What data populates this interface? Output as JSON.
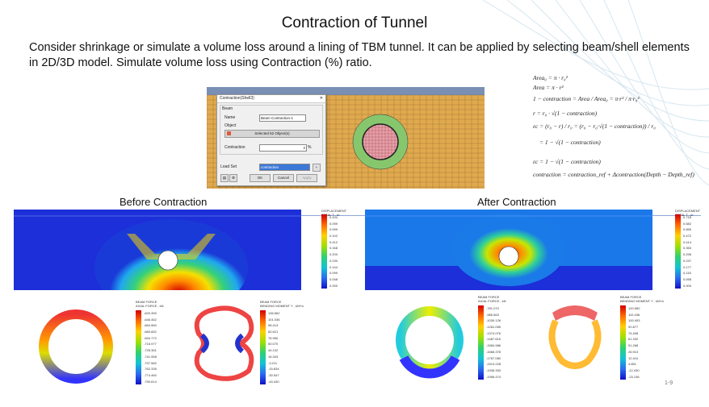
{
  "slide": {
    "title": "Contraction of Tunnel",
    "body": "Consider shrinkage or simulate a volume loss around a lining of TBM tunnel. It can be applied by selecting beam/shell elements in 2D/3D model. Simulate volume loss using Contraction (%) ratio.",
    "page_number": "1-9"
  },
  "dialog": {
    "title": "Contraction(Shell3)",
    "close": "✕",
    "group_beam": "Beam",
    "name_label": "Name",
    "name_value": "Beam Contraction-1",
    "object_label": "Object",
    "object_button": "Selected 52 Object(s)",
    "contraction_label": "Contraction",
    "contraction_value": "2",
    "contraction_unit": "%",
    "load_set_label": "Load Set",
    "load_set_value": "contraction",
    "ok": "OK",
    "cancel": "Cancel",
    "apply": "Apply"
  },
  "formulas": [
    "Area₀ = π · r₀²",
    "Area = π · r²",
    "1 − contraction = Area / Area₀ = π·r² / π·r₀²",
    "r = r₀ · √(1 − contraction)",
    "εc = (r₀ − r) / r₀ = (r₀ − r₀·√(1 − contraction)) / r₀",
    "= 1 − √(1 − contraction)",
    "εc = 1 − √(1 − contraction)",
    "contraction = contraction_ref + Δcontraction(Depth − Depth_ref)"
  ],
  "before": {
    "label": "Before Contraction",
    "legend_title": "DISPLACEMENT\nTOTAL T , m",
    "legend_values": [
      "0.104",
      "0.099",
      "0.099",
      "0.102",
      "0.412",
      "0.348",
      "0.203",
      "0.230",
      "0.144",
      "0.099",
      "0.048",
      "0.000"
    ]
  },
  "after": {
    "label": "After Contraction",
    "legend_title": "DISPLACEMENT\nTOTAL T , m",
    "legend_values": [
      "0.718",
      "0.582",
      "0.565",
      "0.472",
      "0.414",
      "0.353",
      "0.296",
      "0.237",
      "0.177",
      "0.118",
      "0.058",
      "0.000"
    ]
  },
  "force_plots": [
    {
      "legend_title": "BEAM FORCE\nAXIAL FORCE , kN",
      "values": [
        "-629.390",
        "-646.462",
        "-664.560",
        "-680.652",
        "-694.772",
        "-716.977",
        "-728.361",
        "-741.958",
        "-757.582",
        "-762.335",
        "-774.460",
        "-790.614"
      ]
    },
    {
      "legend_title": "BEAM FORCE\nBENDING MOMENT Y , kN*m",
      "values": [
        "136.562",
        "101.036",
        "98.413",
        "82.621",
        "76.950",
        "50.070",
        "44.102",
        "16.343",
        "-3.211",
        "-15.834",
        "-30.547",
        "-43.430"
      ]
    },
    {
      "legend_title": "BEAM FORCE\nAXIAL FORCE , kN",
      "values": [
        "-781.070",
        "-985.563",
        "-1030.126",
        "-1281.055",
        "-1374.076",
        "-1487.615",
        "-1584.986",
        "-1668.378",
        "-1767.080",
        "-1913.228",
        "-1936.353",
        "-1956.474"
      ]
    },
    {
      "legend_title": "BEAM FORCE\nBENDING MOMENT Y , kN*m",
      "values": [
        "120.960",
        "110.436",
        "100.493",
        "92.877",
        "74.408",
        "61.332",
        "51.268",
        "26.913",
        "12.410",
        "4.851",
        "-12.430",
        "-23.136"
      ]
    }
  ]
}
